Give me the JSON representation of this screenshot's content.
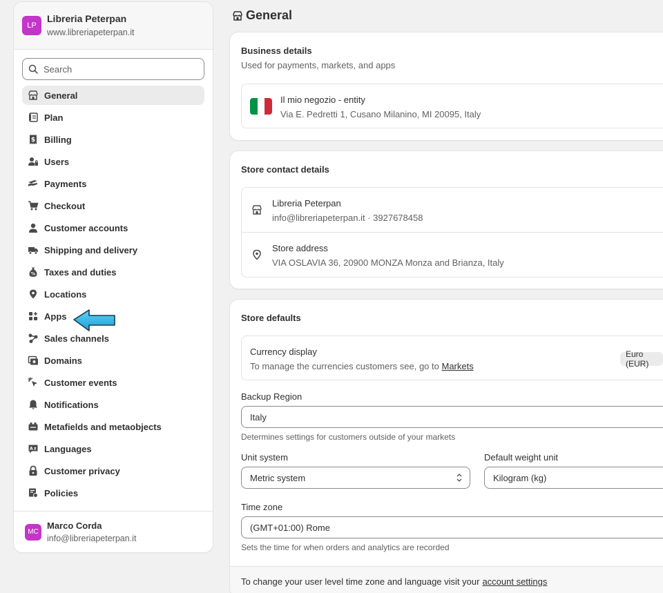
{
  "store": {
    "initials": "LP",
    "name": "Libreria Peterpan",
    "url": "www.libreriapeterpan.it"
  },
  "search": {
    "placeholder": "Search"
  },
  "nav": {
    "items": [
      {
        "label": "General",
        "icon": "store-icon"
      },
      {
        "label": "Plan",
        "icon": "plan-icon"
      },
      {
        "label": "Billing",
        "icon": "receipt-dollar-icon"
      },
      {
        "label": "Users",
        "icon": "users-icon"
      },
      {
        "label": "Payments",
        "icon": "payments-icon"
      },
      {
        "label": "Checkout",
        "icon": "cart-icon"
      },
      {
        "label": "Customer accounts",
        "icon": "person-icon"
      },
      {
        "label": "Shipping and delivery",
        "icon": "truck-icon"
      },
      {
        "label": "Taxes and duties",
        "icon": "tax-icon"
      },
      {
        "label": "Locations",
        "icon": "location-icon"
      },
      {
        "label": "Apps",
        "icon": "apps-icon"
      },
      {
        "label": "Sales channels",
        "icon": "channels-icon"
      },
      {
        "label": "Domains",
        "icon": "domains-icon"
      },
      {
        "label": "Customer events",
        "icon": "cursor-click-icon"
      },
      {
        "label": "Notifications",
        "icon": "bell-icon"
      },
      {
        "label": "Metafields and metaobjects",
        "icon": "metafields-icon"
      },
      {
        "label": "Languages",
        "icon": "language-icon"
      },
      {
        "label": "Customer privacy",
        "icon": "lock-icon"
      },
      {
        "label": "Policies",
        "icon": "policies-icon"
      }
    ]
  },
  "user": {
    "initials": "MC",
    "name": "Marco Corda",
    "email": "info@libreriapeterpan.it"
  },
  "page": {
    "title": "General"
  },
  "business": {
    "title": "Business details",
    "subtitle": "Used for payments, markets, and apps",
    "entity_name": "Il mio negozio - entity",
    "entity_address": "Via E. Pedretti 1, Cusano Milanino, MI 20095, Italy",
    "flag_colors": [
      "#009246",
      "#ffffff",
      "#ce2b37"
    ]
  },
  "contact": {
    "title": "Store contact details",
    "store_name": "Libreria Peterpan",
    "store_contact": "info@libreriapeterpan.it · 3927678458",
    "address_label": "Store address",
    "address_value": "VIA OSLAVIA 36, 20900 MONZA Monza and Brianza, Italy"
  },
  "defaults": {
    "title": "Store defaults",
    "currency_label": "Currency display",
    "currency_sub": "To manage the currencies customers see, go to",
    "currency_link": "Markets",
    "currency_badge": "Euro (EUR)",
    "backup_region_label": "Backup Region",
    "backup_region_value": "Italy",
    "backup_region_help": "Determines settings for customers outside of your markets",
    "unit_system_label": "Unit system",
    "unit_system_value": "Metric system",
    "weight_unit_label": "Default weight unit",
    "weight_unit_value": "Kilogram (kg)",
    "timezone_label": "Time zone",
    "timezone_value": "(GMT+01:00) Rome",
    "timezone_help": "Sets the time for when orders and analytics are recorded",
    "footer_text": "To change your user level time zone and language visit your",
    "footer_link": "account settings"
  },
  "colors": {
    "accent_arrow": "#29b6e8",
    "avatar": "#c435c9"
  }
}
